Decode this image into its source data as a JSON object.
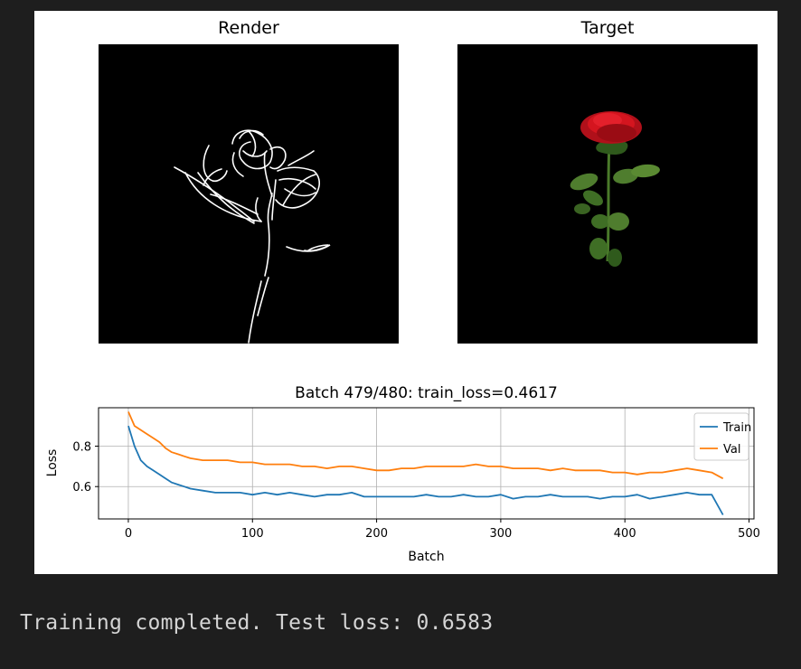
{
  "panels": {
    "render_title": "Render",
    "target_title": "Target"
  },
  "console": {
    "message": "Training completed. Test loss: 0.6583"
  },
  "chart_data": {
    "type": "line",
    "title": "Batch 479/480: train_loss=0.4617",
    "xlabel": "Batch",
    "ylabel": "Loss",
    "xlim": [
      -24,
      504
    ],
    "ylim": [
      0.44,
      0.99
    ],
    "xticks": [
      0,
      100,
      200,
      300,
      400,
      500
    ],
    "yticks": [
      0.6,
      0.8
    ],
    "xtick_labels": [
      "0",
      "100",
      "200",
      "300",
      "400",
      "500"
    ],
    "ytick_labels": [
      "0.6",
      "0.8"
    ],
    "grid": true,
    "legend_position": "upper right",
    "series": [
      {
        "name": "Train",
        "color": "#1f77b4",
        "x": [
          0,
          5,
          10,
          15,
          20,
          25,
          30,
          35,
          40,
          45,
          50,
          60,
          70,
          80,
          90,
          100,
          110,
          120,
          130,
          140,
          150,
          160,
          170,
          180,
          190,
          200,
          210,
          220,
          230,
          240,
          250,
          260,
          270,
          280,
          290,
          300,
          310,
          320,
          330,
          340,
          350,
          360,
          370,
          380,
          390,
          400,
          410,
          420,
          430,
          440,
          450,
          460,
          470,
          479
        ],
        "y": [
          0.9,
          0.8,
          0.73,
          0.7,
          0.68,
          0.66,
          0.64,
          0.62,
          0.61,
          0.6,
          0.59,
          0.58,
          0.57,
          0.57,
          0.57,
          0.56,
          0.57,
          0.56,
          0.57,
          0.56,
          0.55,
          0.56,
          0.56,
          0.57,
          0.55,
          0.55,
          0.55,
          0.55,
          0.55,
          0.56,
          0.55,
          0.55,
          0.56,
          0.55,
          0.55,
          0.56,
          0.54,
          0.55,
          0.55,
          0.56,
          0.55,
          0.55,
          0.55,
          0.54,
          0.55,
          0.55,
          0.56,
          0.54,
          0.55,
          0.56,
          0.57,
          0.56,
          0.56,
          0.46
        ]
      },
      {
        "name": "Val",
        "color": "#ff7f0e",
        "x": [
          0,
          5,
          10,
          15,
          20,
          25,
          30,
          35,
          40,
          45,
          50,
          60,
          70,
          80,
          90,
          100,
          110,
          120,
          130,
          140,
          150,
          160,
          170,
          180,
          190,
          200,
          210,
          220,
          230,
          240,
          250,
          260,
          270,
          280,
          290,
          300,
          310,
          320,
          330,
          340,
          350,
          360,
          370,
          380,
          390,
          400,
          410,
          420,
          430,
          440,
          450,
          460,
          470,
          479
        ],
        "y": [
          0.97,
          0.9,
          0.88,
          0.86,
          0.84,
          0.82,
          0.79,
          0.77,
          0.76,
          0.75,
          0.74,
          0.73,
          0.73,
          0.73,
          0.72,
          0.72,
          0.71,
          0.71,
          0.71,
          0.7,
          0.7,
          0.69,
          0.7,
          0.7,
          0.69,
          0.68,
          0.68,
          0.69,
          0.69,
          0.7,
          0.7,
          0.7,
          0.7,
          0.71,
          0.7,
          0.7,
          0.69,
          0.69,
          0.69,
          0.68,
          0.69,
          0.68,
          0.68,
          0.68,
          0.67,
          0.67,
          0.66,
          0.67,
          0.67,
          0.68,
          0.69,
          0.68,
          0.67,
          0.64
        ]
      }
    ]
  }
}
